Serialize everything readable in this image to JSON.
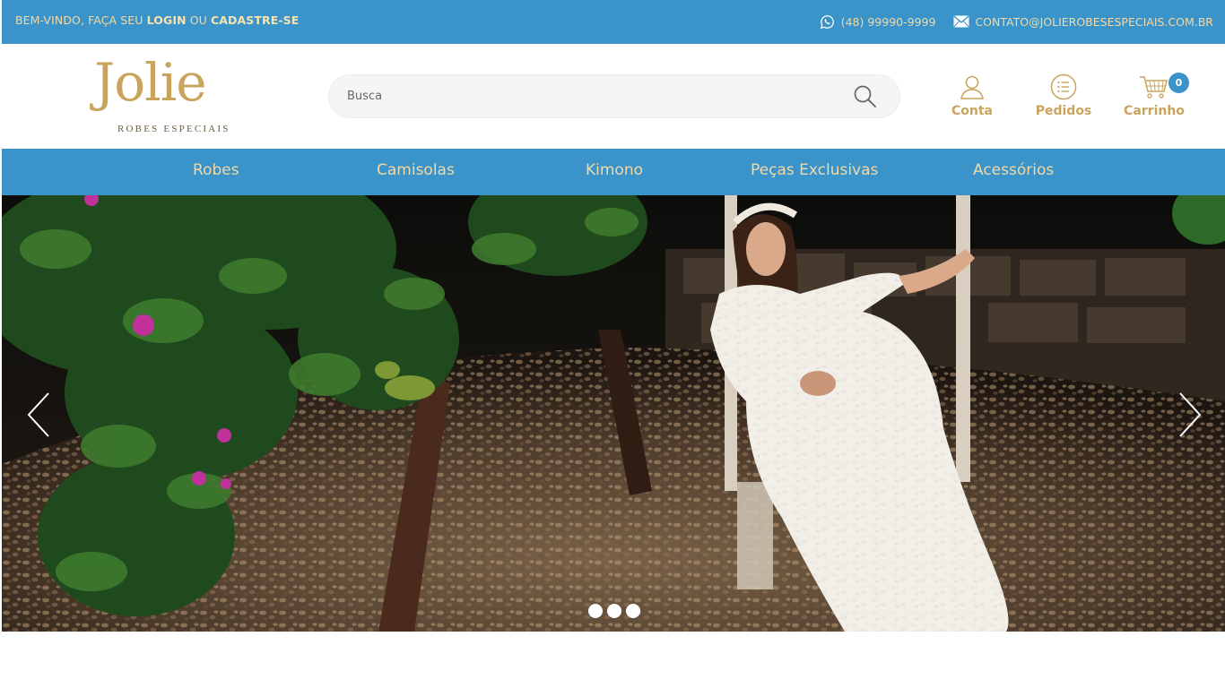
{
  "topbar": {
    "welcome_prefix": "BEM-VINDO, FAÇA SEU ",
    "login_label": "LOGIN",
    "or_label": " OU ",
    "register_label": "CADASTRE-SE",
    "phone": "(48) 99990-9999",
    "phone_icon": "whatsapp-icon",
    "email": "CONTATO@JOLIEROBESESPECIAIS.COM.BR",
    "email_icon": "envelope-icon"
  },
  "header": {
    "logo_word": "Jolie",
    "logo_sub": "ROBES ESPECIAIS",
    "search_placeholder": "Busca",
    "search_icon": "magnifier-icon",
    "account_label": "Conta",
    "account_icon": "user-icon",
    "orders_label": "Pedidos",
    "orders_icon": "list-icon",
    "cart_label": "Carrinho",
    "cart_icon": "cart-icon",
    "cart_count": "0"
  },
  "nav": {
    "items": [
      {
        "label": "Robes"
      },
      {
        "label": "Camisolas"
      },
      {
        "label": "Kimono"
      },
      {
        "label": "Peças Exclusivas"
      },
      {
        "label": "Acessórios"
      }
    ]
  },
  "carousel": {
    "prev_icon": "chevron-left-icon",
    "next_icon": "chevron-right-icon",
    "slide_count": 3,
    "active_slide": 1
  },
  "colors": {
    "brand_blue": "#3a93c9",
    "gold": "#c9a45c",
    "cream_text": "#f3d9a5"
  }
}
